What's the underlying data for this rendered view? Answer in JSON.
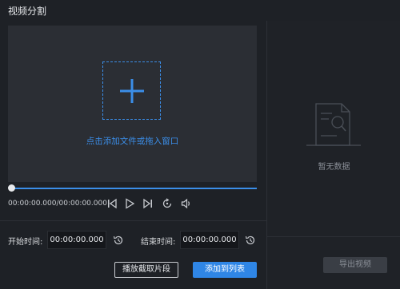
{
  "window": {
    "title": "视频分割"
  },
  "preview": {
    "drop_hint": "点击添加文件或拖入窗口"
  },
  "player": {
    "timecode": "00:00:00.000/00:00:00.000",
    "progress": 0
  },
  "range": {
    "start_label": "开始时间:",
    "start_value": "00:00:00.000",
    "end_label": "结束时间:",
    "end_value": "00:00:00.000"
  },
  "actions": {
    "play_clip_label": "播放截取片段",
    "add_to_list_label": "添加到列表"
  },
  "list_panel": {
    "empty_text": "暂无数据",
    "export_label": "导出视频"
  },
  "colors": {
    "accent": "#3b8ee8",
    "background": "#1e2126",
    "preview_bg": "#2b2e34"
  },
  "icons": [
    "plus-icon",
    "prev-frame-icon",
    "play-icon",
    "next-frame-icon",
    "loop-icon",
    "volume-icon",
    "reset-time-icon",
    "empty-document-icon"
  ]
}
